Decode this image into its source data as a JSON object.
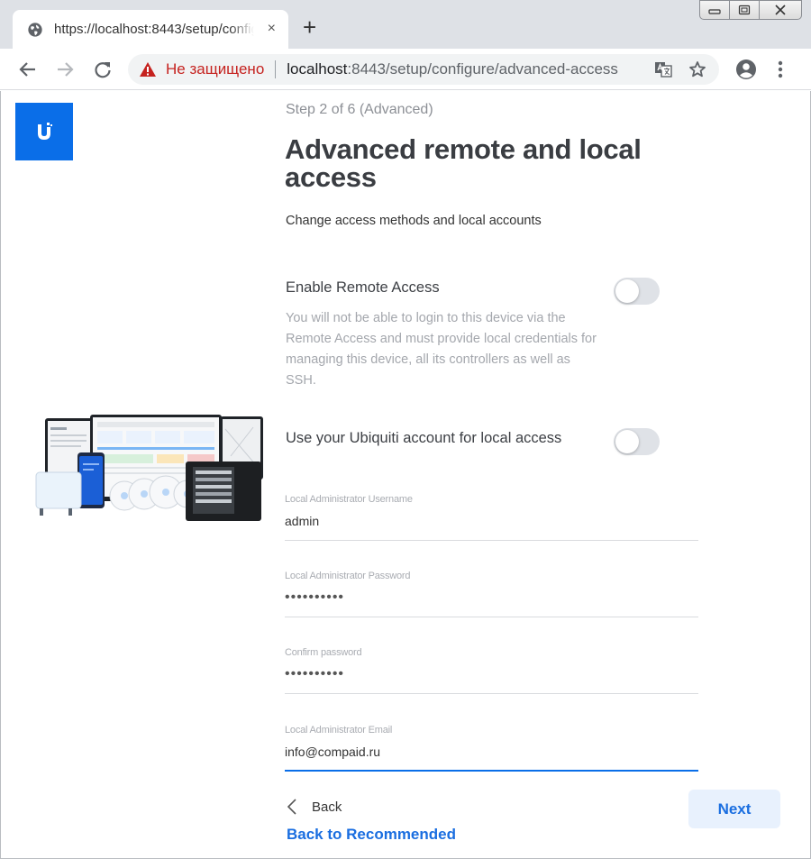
{
  "browser": {
    "tab_title": "https://localhost:8443/setup/configure/advanced-access",
    "tab_close": "×",
    "new_tab": "+",
    "not_secure": "Не защищено",
    "url_host": "localhost",
    "url_path": ":8443/setup/configure/advanced-access"
  },
  "page": {
    "step": "Step 2 of 6 (Advanced)",
    "title": "Advanced remote and local access",
    "subtitle": "Change access methods and local accounts",
    "remote_access": {
      "label": "Enable Remote Access",
      "description": "You will not be able to login to this device via the Remote Access and must provide local credentials for managing this device, all its controllers as well as SSH.",
      "enabled": false
    },
    "ubiquiti_account": {
      "label": "Use your Ubiquiti account for local access",
      "enabled": false
    },
    "fields": {
      "username": {
        "label": "Local Administrator Username",
        "value": "admin"
      },
      "password": {
        "label": "Local Administrator Password",
        "value": "••••••••••"
      },
      "confirm": {
        "label": "Confirm password",
        "value": "••••••••••"
      },
      "email": {
        "label": "Local Administrator Email",
        "value": "info@compaid.ru"
      }
    },
    "back_label": "Back",
    "back_recommended": "Back to Recommended",
    "next_label": "Next"
  },
  "colors": {
    "brand": "#0a6ee8",
    "link": "#1a6ee0",
    "warning": "#c5221f",
    "next_bg": "#e8f1fd"
  }
}
